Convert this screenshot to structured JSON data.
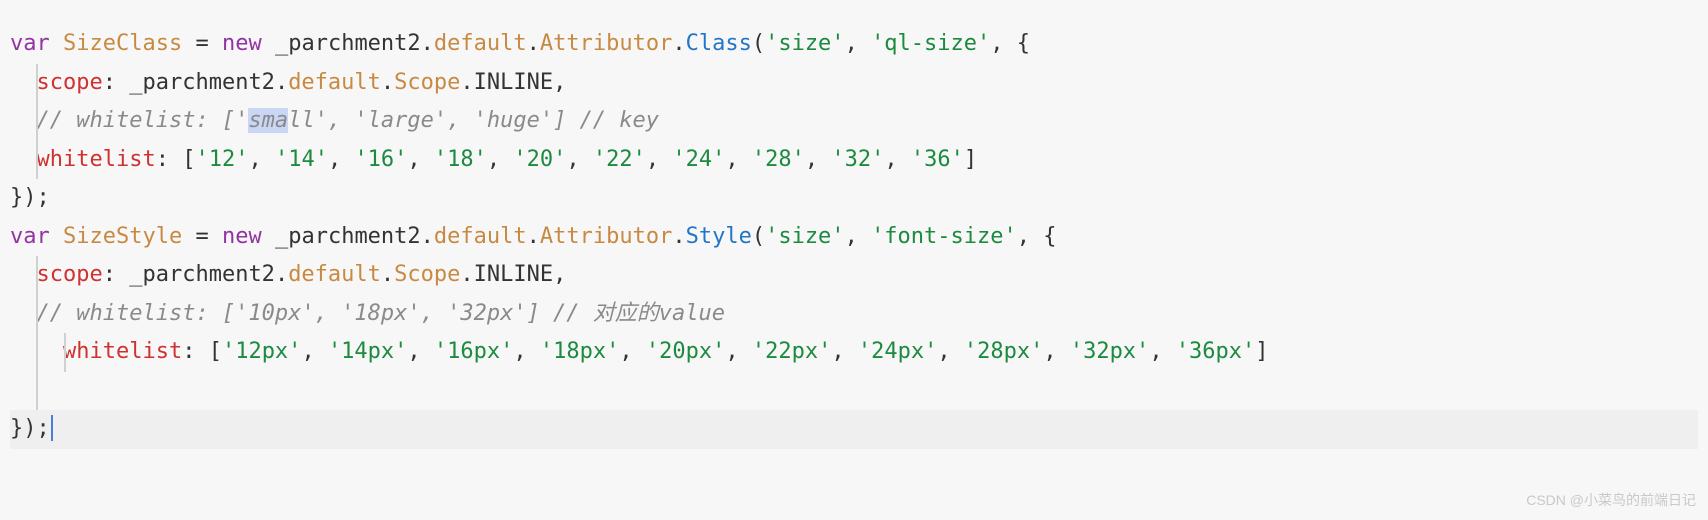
{
  "code": {
    "line1": {
      "var": "var",
      "space1": " ",
      "name": "SizeClass",
      "eq": " = ",
      "new": "new",
      "space2": " ",
      "obj": "_parchment2",
      "dot1": ".",
      "default": "default",
      "dot2": ".",
      "attr": "Attributor",
      "dot3": ".",
      "method": "Class",
      "open": "(",
      "str1": "'size'",
      "comma1": ", ",
      "str2": "'ql-size'",
      "comma2": ", {"
    },
    "line2": {
      "indent": "  ",
      "prop": "scope",
      "colon": ": ",
      "obj": "_parchment2",
      "dot1": ".",
      "default": "default",
      "dot2": ".",
      "scope": "Scope",
      "dot3": ".",
      "inline": "INLINE",
      "comma": ","
    },
    "line3": {
      "indent": "  ",
      "comment_pre": "// whitelist: ['",
      "sel": "sma",
      "comment_post": "ll', 'large', 'huge'] // key"
    },
    "line4": {
      "indent": "  ",
      "prop": "whitelist",
      "colon": ": [",
      "v1": "'12'",
      "c1": ", ",
      "v2": "'14'",
      "c2": ", ",
      "v3": "'16'",
      "c3": ", ",
      "v4": "'18'",
      "c4": ", ",
      "v5": "'20'",
      "c5": ", ",
      "v6": "'22'",
      "c6": ", ",
      "v7": "'24'",
      "c7": ", ",
      "v8": "'28'",
      "c8": ", ",
      "v9": "'32'",
      "c9": ", ",
      "v10": "'36'",
      "close": "]"
    },
    "line5": {
      "close": "});"
    },
    "line6": {
      "var": "var",
      "space1": " ",
      "name": "SizeStyle",
      "eq": " = ",
      "new": "new",
      "space2": " ",
      "obj": "_parchment2",
      "dot1": ".",
      "default": "default",
      "dot2": ".",
      "attr": "Attributor",
      "dot3": ".",
      "method": "Style",
      "open": "(",
      "str1": "'size'",
      "comma1": ", ",
      "str2": "'font-size'",
      "comma2": ", {"
    },
    "line7": {
      "indent": "  ",
      "prop": "scope",
      "colon": ": ",
      "obj": "_parchment2",
      "dot1": ".",
      "default": "default",
      "dot2": ".",
      "scope": "Scope",
      "dot3": ".",
      "inline": "INLINE",
      "comma": ","
    },
    "line8": {
      "indent": "  ",
      "comment": "// whitelist: ['10px', '18px', '32px'] // 对应的value"
    },
    "line9": {
      "indent": "    ",
      "prop": "whitelist",
      "colon": ": [",
      "v1": "'12px'",
      "c1": ", ",
      "v2": "'14px'",
      "c2": ", ",
      "v3": "'16px'",
      "c3": ", ",
      "v4": "'18px'",
      "c4": ", ",
      "v5": "'20px'",
      "c5": ", ",
      "v6": "'22px'",
      "c6": ", ",
      "v7": "'24px'",
      "c7": ", ",
      "v8": "'28px'",
      "c8": ", ",
      "v9": "'32px'",
      "c9": ", ",
      "v10": "'36px'",
      "close": "]"
    },
    "line10": {
      "blank": " "
    },
    "line11": {
      "close": "});"
    }
  },
  "watermark": "CSDN @小菜鸟的前端日记"
}
